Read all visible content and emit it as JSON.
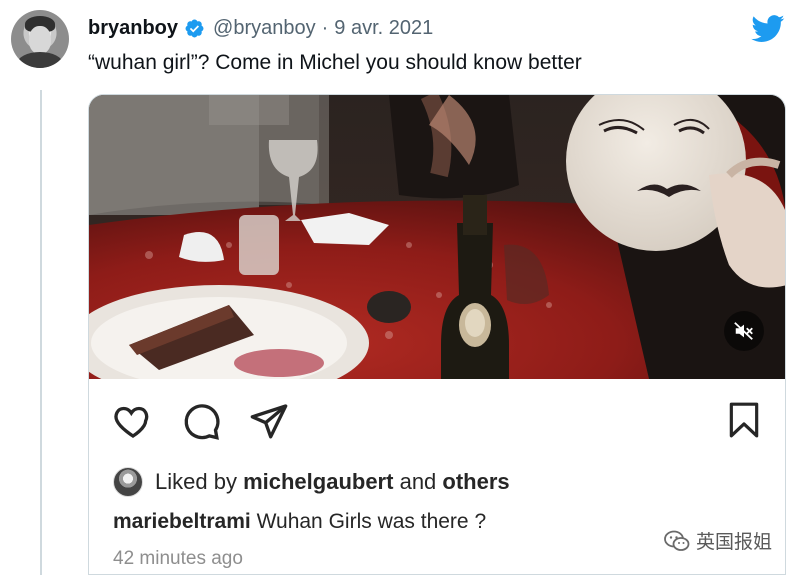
{
  "tweet": {
    "display_name": "bryanboy",
    "handle": "@bryanboy",
    "separator": "·",
    "date": "9 avr. 2021",
    "text": "“wuhan girl”? Come in Michel you should know better",
    "verified": true,
    "icons": {
      "verified": "verified-badge-icon",
      "brand": "twitter-bird-icon"
    },
    "colors": {
      "brand_blue": "#1d9bf0",
      "handle_gray": "#536471"
    }
  },
  "instagram_post": {
    "liked_prefix": "Liked by",
    "liked_user": "michelgaubert",
    "liked_and": "and",
    "liked_others": "others",
    "caption_user": "mariebeltrami",
    "caption_text": "Wuhan Girls was there ?",
    "timestamp": "42 minutes ago",
    "icons": {
      "like": "heart-icon",
      "comment": "comment-icon",
      "share": "send-icon",
      "save": "bookmark-icon",
      "mute": "muted-speaker-icon"
    }
  },
  "watermark": {
    "text": "英国报姐",
    "icon": "wechat-icon"
  }
}
